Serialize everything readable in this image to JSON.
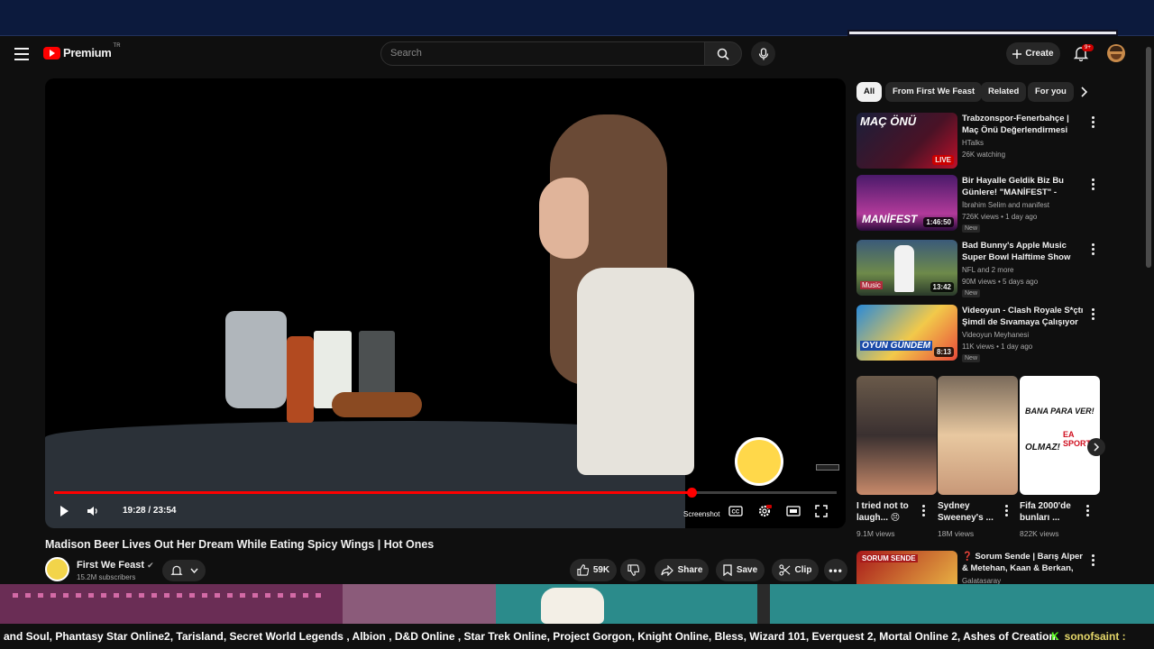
{
  "masthead": {
    "logo_text": "Premium",
    "country_code": "TR",
    "search_placeholder": "Search",
    "create_label": "Create",
    "notif_badge": "9+"
  },
  "player": {
    "time": "19:28 / 23:54",
    "progress": 0.8147,
    "screenshot_label": "Screenshot"
  },
  "video": {
    "title": "Madison Beer Lives Out Her Dream While Eating Spicy Wings | Hot Ones",
    "channel": "First We Feast",
    "subscribers": "15.2M subscribers",
    "likes": "59K",
    "share": "Share",
    "save": "Save",
    "clip": "Clip"
  },
  "chips": [
    "All",
    "From First We Feast",
    "Related",
    "For you"
  ],
  "recommendations": [
    {
      "title": "Trabzonspor-Fenerbahçe | Maç Önü Değerlendirmesi",
      "channel": "HTalks",
      "meta": "26K watching",
      "badge": "LIVE",
      "new": ""
    },
    {
      "title": "Bir Hayalle Geldik Biz Bu Günlere! \"MANİFEST\" - İbrahi...",
      "channel": "İbrahim Selim  and manifest",
      "meta": "726K views • 1 day ago",
      "badge": "1:46:50",
      "new": "New"
    },
    {
      "title": "Bad Bunny's Apple Music Super Bowl Halftime Show",
      "channel": "NFL  and 2 more",
      "meta": "90M views • 5 days ago",
      "badge": "13:42",
      "new": "New"
    },
    {
      "title": "Videoyun - Clash Royale S*çtı Şimdi de Sıvamaya Çalışıyor",
      "channel": "Videoyun Meyhanesi",
      "meta": "11K views • 1 day ago",
      "badge": "8:13",
      "new": "New"
    },
    {
      "title": "❓ Sorum Sende | Barış Alper & Metehan, Kaan & Berkan, Gun...",
      "channel": "Galatasaray",
      "meta": "",
      "badge": "",
      "new": ""
    }
  ],
  "shorts": [
    {
      "title": "I tried not to laugh... 😣",
      "views": "9.1M views"
    },
    {
      "title": "Sydney Sweeney's ...",
      "views": "18M views"
    },
    {
      "title": "Fifa 2000'de bunları ...",
      "views": "822K views"
    }
  ],
  "thumb_text": {
    "mac_onu": "MAÇ ÖNÜ",
    "manifest": "MANİFEST",
    "music": "Music",
    "oyun": "OYUN GÜNDEM",
    "sorum": "SORUM SENDE",
    "bana": "BANA PARA VER!",
    "olmaz": "OLMAZ!",
    "ea": "EA SPORTS"
  },
  "ticker": {
    "text": "and Soul, Phantasy Star Online2, Tarisland, Secret World Legends , Albion , D&D Online , Star Trek Online, Project Gorgon, Knight Online, Bless, Wizard 101, Everquest 2, Mortal Online 2, Ashes of Creation.",
    "user": "sonofsaint :"
  },
  "colors": {
    "accent": "#ff0000",
    "background": "#0f0f0f",
    "chip": "#272727"
  }
}
